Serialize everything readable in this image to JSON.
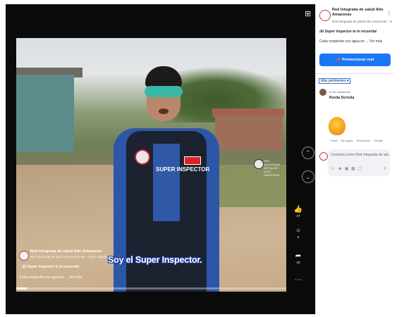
{
  "video": {
    "subtitle": "Soy el Super Inspector.",
    "progress_fraction": 0.04,
    "overlay": {
      "page_name": "Red Integrada de salud Alto Amazonas",
      "meta": "Red integrada de salud Alto Amazonas · Audio original",
      "tag": "¡El Super Inspector te lo recuerda!",
      "description": "Cada recipiente con agua en ... Ver más"
    },
    "shirt_text": "SUPER INSPECTOR",
    "watermark": "RED INTEGRADA DE SALUD ALTO AMAZONAS"
  },
  "side_actions": {
    "likes": "27",
    "comments": "5",
    "shares": "15"
  },
  "icons": {
    "fullscreen": "expand-icon",
    "prev": "chevron-up-icon",
    "next": "chevron-down-icon",
    "like": "thumbs-up-icon",
    "comment": "comment-icon",
    "share": "share-icon",
    "more": "more-icon"
  },
  "panel": {
    "page_name": "Red Integrada de salud Alto Amazonas",
    "audio": "Red integrada de salud Alto Amazonas · Au...",
    "tag": "¡El Super Inspector te lo recuerda!",
    "description": "Cada recipiente con agua en ... Ver más",
    "promote_label": "Promocionar reel",
    "sort_label": "Más pertinentes",
    "comment": {
      "role": "Fan destacado",
      "author": "Roxita Dorisita",
      "actions": [
        "1 sem",
        "Me gusta",
        "Responder",
        "Ocultar"
      ]
    },
    "input_placeholder": "Comenta como Red integrada de sal..."
  },
  "colors": {
    "brand_blue": "#1877f2",
    "subtitle_outline": "#1d3aa0",
    "mask": "#3bb7a8"
  }
}
